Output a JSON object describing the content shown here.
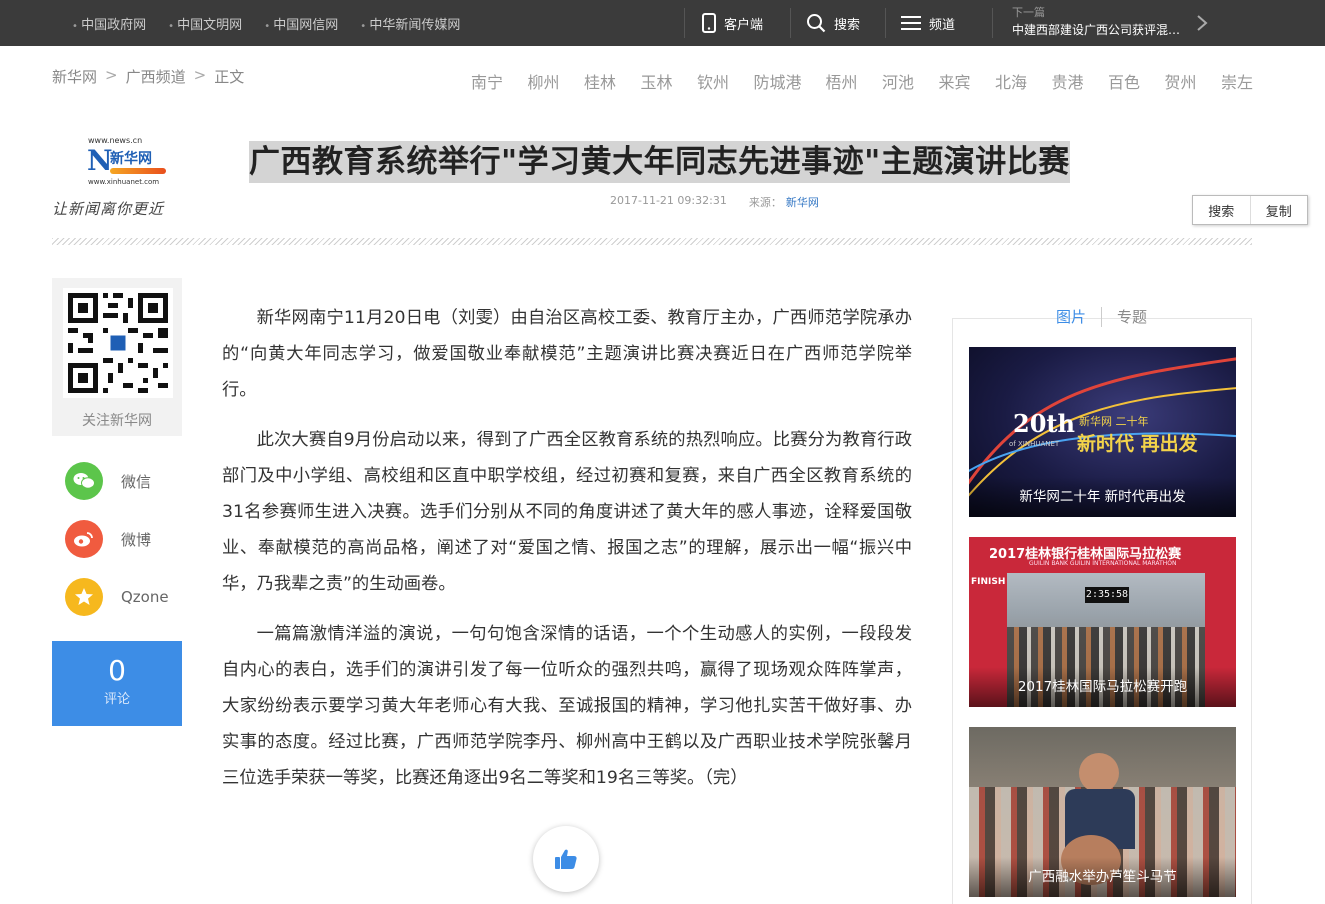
{
  "topbar": {
    "links": [
      "中国政府网",
      "中国文明网",
      "中国网信网",
      "中华新闻传媒网"
    ],
    "client_label": "客户端",
    "search_label": "搜索",
    "channel_label": "频道",
    "next_label": "下一篇",
    "next_title": "中建西部建设广西公司获评混凝土企业"
  },
  "breadcrumb": {
    "items": [
      "新华网",
      "广西频道",
      "正文"
    ],
    "sep": ">"
  },
  "cities": [
    "南宁",
    "柳州",
    "桂林",
    "玉林",
    "钦州",
    "防城港",
    "梧州",
    "河池",
    "来宾",
    "北海",
    "贵港",
    "百色",
    "贺州",
    "崇左"
  ],
  "logo": {
    "url_top": "www.news.cn",
    "brand": "新华网",
    "url_bottom": "www.xinhuanet.com",
    "slogan": "让新闻离你更近"
  },
  "article": {
    "title": "广西教育系统举行\"学习黄大年同志先进事迹\"主题演讲比赛",
    "datetime": "2017-11-21 09:32:31",
    "source_label": "来源：",
    "source": "新华网",
    "paragraphs": [
      "新华网南宁11月20日电（刘雯）由自治区高校工委、教育厅主办，广西师范学院承办的“向黄大年同志学习，做爱国敬业奉献模范”主题演讲比赛决赛近日在广西师范学院举行。",
      "此次大赛自9月份启动以来，得到了广西全区教育系统的热烈响应。比赛分为教育行政部门及中小学组、高校组和区直中职学校组，经过初赛和复赛，来自广西全区教育系统的31名参赛师生进入决赛。选手们分别从不同的角度讲述了黄大年的感人事迹，诠释爱国敬业、奉献模范的高尚品格，阐述了对“爱国之情、报国之志”的理解，展示出一幅“振兴中华，乃我辈之责”的生动画卷。",
      "一篇篇激情洋溢的演说，一句句饱含深情的话语，一个个生动感人的实例，一段段发自内心的表白，选手们的演讲引发了每一位听众的强烈共鸣，赢得了现场观众阵阵掌声，大家纷纷表示要学习黄大年老师心有大我、至诚报国的精神，学习他扎实苦干做好事、办实事的态度。经过比赛，广西师范学院李丹、柳州高中王鹤以及广西职业技术学院张馨月三位选手荣获一等奖，比赛还角逐出9名二等奖和19名三等奖。（完）"
    ]
  },
  "context_menu": {
    "search": "搜索",
    "copy": "复制"
  },
  "share": {
    "follow_label": "关注新华网",
    "wechat": "微信",
    "weibo": "微博",
    "qzone": "Qzone",
    "comment_count": "0",
    "comment_label": "评论"
  },
  "sidebar": {
    "tabs": [
      "图片",
      "专题"
    ],
    "pictures": [
      {
        "caption": "新华网二十年 新时代再出发",
        "overlay_top": "新华网 二十年",
        "overlay_main": "新时代 再出发",
        "badge": "20th",
        "badge_sub": "of XINHUANET"
      },
      {
        "caption": "2017桂林国际马拉松赛开跑",
        "banner": "2017桂林银行桂林国际马拉松赛",
        "banner_en": "GUILIN BANK GUILIN INTERNATIONAL MARATHON",
        "clock": "2:35:58",
        "finish": "FINISH"
      },
      {
        "caption": "广西融水举办芦笙斗马节"
      }
    ]
  },
  "colors": {
    "topbar": "#3b3b3b",
    "accent": "#3d8de6",
    "wechat": "#5cc54b",
    "weibo": "#f05b3f",
    "qzone": "#f6b81e"
  }
}
